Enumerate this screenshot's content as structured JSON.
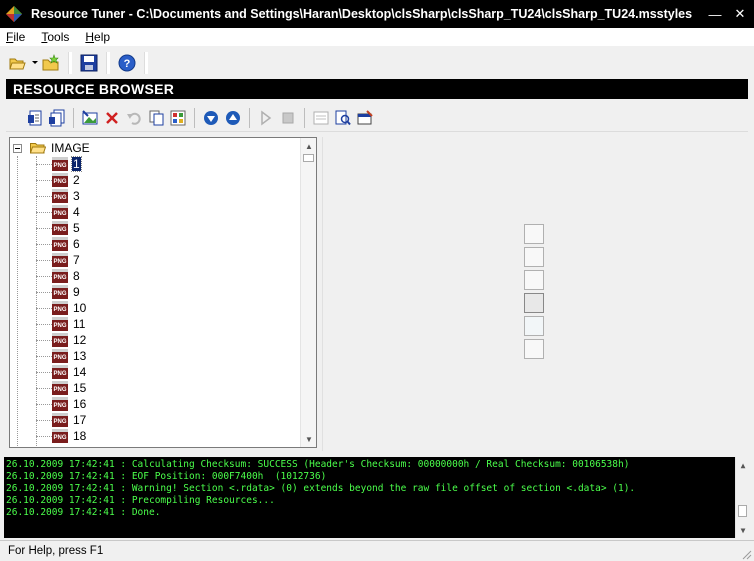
{
  "window": {
    "title": "Resource Tuner - C:\\Documents and Settings\\Haran\\Desktop\\clsSharp\\clsSharp_TU24\\clsSharp_TU24.msstyles",
    "minimize_glyph": "—",
    "close_glyph": "✕"
  },
  "menu": {
    "items": [
      {
        "label": "File",
        "accel": "F",
        "rest": "ile"
      },
      {
        "label": "Tools",
        "accel": "T",
        "rest": "ools"
      },
      {
        "label": "Help",
        "accel": "H",
        "rest": "elp"
      }
    ]
  },
  "browser": {
    "header": "RESOURCE BROWSER"
  },
  "tree": {
    "root_label": "IMAGE",
    "items": [
      "1",
      "2",
      "3",
      "4",
      "5",
      "6",
      "7",
      "8",
      "9",
      "10",
      "11",
      "12",
      "13",
      "14",
      "15",
      "16",
      "17",
      "18"
    ],
    "selected_index": 0,
    "item_icon_text": "PNG"
  },
  "log": {
    "lines": [
      "26.10.2009 17:42:41 : Calculating Checksum: SUCCESS (Header's Checksum: 00000000h / Real Checksum: 00106538h)",
      "26.10.2009 17:42:41 : EOF Position: 000F7400h  (1012736)",
      "26.10.2009 17:42:41 : Warning! Section <.rdata> (0) extends beyond the raw file offset of section <.data> (1).",
      "26.10.2009 17:42:41 : Precompiling Resources...",
      "26.10.2009 17:42:41 : Done."
    ]
  },
  "status": {
    "text": "For Help, press F1"
  },
  "colors": {
    "titlebar": "#000000",
    "log_background": "#000000",
    "log_text": "#4bff4b",
    "selection": "#0a246a",
    "png_icon": "#7a1d1d"
  }
}
